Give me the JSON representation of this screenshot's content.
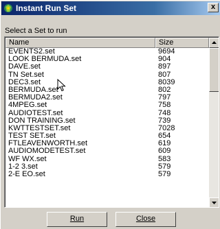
{
  "window": {
    "title": "Instant Run Set",
    "close_glyph": "x"
  },
  "prompt": "Select a Set to run",
  "list": {
    "columns": [
      "Name",
      "Size"
    ],
    "rows": [
      {
        "name": "EVENTS2.set",
        "size": "9694"
      },
      {
        "name": "LOOK BERMUDA.set",
        "size": "904"
      },
      {
        "name": "DAVE.set",
        "size": "897"
      },
      {
        "name": "TN Set.set",
        "size": "807"
      },
      {
        "name": "DEC3.set",
        "size": "8039"
      },
      {
        "name": "BERMUDA.set",
        "size": "802"
      },
      {
        "name": "BERMUDA2.set",
        "size": "797"
      },
      {
        "name": "4MPEG.set",
        "size": "758"
      },
      {
        "name": "AUDIOTEST.set",
        "size": "748"
      },
      {
        "name": "DON TRAINING.set",
        "size": "739"
      },
      {
        "name": "KWTTESTSET.set",
        "size": "7028"
      },
      {
        "name": "TEST SET.set",
        "size": "654"
      },
      {
        "name": "FTLEAVENWORTH.set",
        "size": "619"
      },
      {
        "name": "AUDIOMODETEST.set",
        "size": "609"
      },
      {
        "name": "WF WX.set",
        "size": "583"
      },
      {
        "name": "1-2 3.set",
        "size": "579"
      },
      {
        "name": "2-E EO.set",
        "size": "579"
      }
    ]
  },
  "buttons": {
    "run": "Run",
    "close": "Close"
  },
  "icons": {
    "title": "app-icon",
    "cursor": "arrow-cursor-icon"
  }
}
